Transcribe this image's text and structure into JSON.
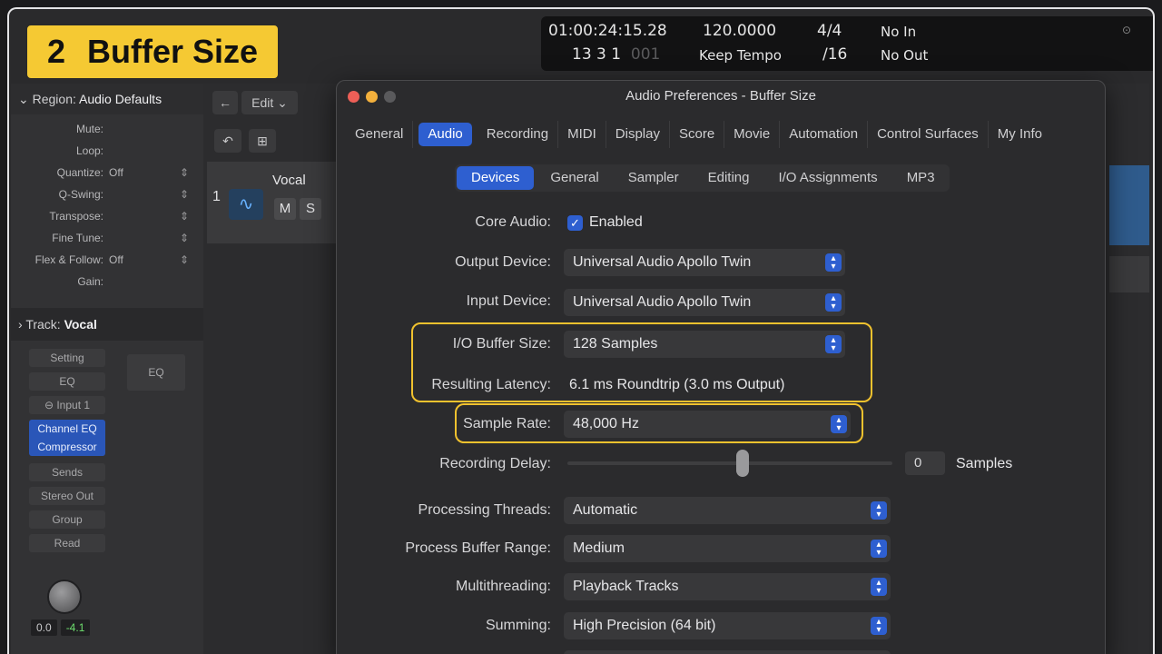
{
  "badge": {
    "number": "2",
    "text": "Buffer Size"
  },
  "transport": {
    "time": "01:00:24:15.28",
    "bars": "13  3  1",
    "bars_dim": "001",
    "tempo": "120.0000",
    "tempo_mode": "Keep Tempo",
    "sig_top": "4/4",
    "sig_bottom": "/16",
    "midi_in": "No In",
    "midi_out": "No Out"
  },
  "inspector": {
    "region_label": "Region:",
    "region_name": "Audio Defaults",
    "rows": [
      {
        "key": "Mute:",
        "value": ""
      },
      {
        "key": "Loop:",
        "value": ""
      },
      {
        "key": "Quantize:",
        "value": "Off"
      },
      {
        "key": "Q-Swing:",
        "value": ""
      },
      {
        "key": "Transpose:",
        "value": ""
      },
      {
        "key": "Fine Tune:",
        "value": ""
      },
      {
        "key": "Flex & Follow:",
        "value": "Off"
      },
      {
        "key": "Gain:",
        "value": ""
      }
    ],
    "track_label": "Track:",
    "track_name": "Vocal",
    "strip": {
      "setting": "Setting",
      "eq": "EQ",
      "input": "Input 1",
      "plugin1": "Channel EQ",
      "plugin2": "Compressor",
      "sends": "Sends",
      "output": "Stereo Out",
      "group": "Group",
      "automation": "Read",
      "pan": "0.0",
      "level": "-4.1"
    },
    "strip2": {
      "eq": "EQ"
    }
  },
  "tracks": {
    "edit_menu": "Edit",
    "track_number": "1",
    "track_name": "Vocal",
    "mute": "M",
    "solo": "S"
  },
  "dialog": {
    "title": "Audio Preferences - Buffer Size",
    "tabs": [
      "General",
      "Audio",
      "Recording",
      "MIDI",
      "Display",
      "Score",
      "Movie",
      "Automation",
      "Control Surfaces",
      "My Info"
    ],
    "active_tab": "Audio",
    "subtabs": [
      "Devices",
      "General",
      "Sampler",
      "Editing",
      "I/O Assignments",
      "MP3"
    ],
    "active_subtab": "Devices",
    "core_audio_label": "Core Audio:",
    "core_audio_value": "Enabled",
    "output_device_label": "Output Device:",
    "output_device": "Universal Audio Apollo Twin",
    "input_device_label": "Input Device:",
    "input_device": "Universal Audio Apollo Twin",
    "buffer_label": "I/O Buffer Size:",
    "buffer_value": "128 Samples",
    "latency_label": "Resulting Latency:",
    "latency_value": "6.1 ms Roundtrip (3.0 ms Output)",
    "sample_rate_label": "Sample Rate:",
    "sample_rate_value": "48,000 Hz",
    "rec_delay_label": "Recording Delay:",
    "rec_delay_value": "0",
    "rec_delay_unit": "Samples",
    "threads_label": "Processing Threads:",
    "threads_value": "Automatic",
    "buffer_range_label": "Process Buffer Range:",
    "buffer_range_value": "Medium",
    "multithreading_label": "Multithreading:",
    "multithreading_value": "Playback Tracks",
    "summing_label": "Summing:",
    "summing_value": "High Precision (64 bit)"
  },
  "colors": {
    "accent": "#2e5fd0",
    "highlight": "#f1c22e",
    "badge": "#f5c933"
  }
}
